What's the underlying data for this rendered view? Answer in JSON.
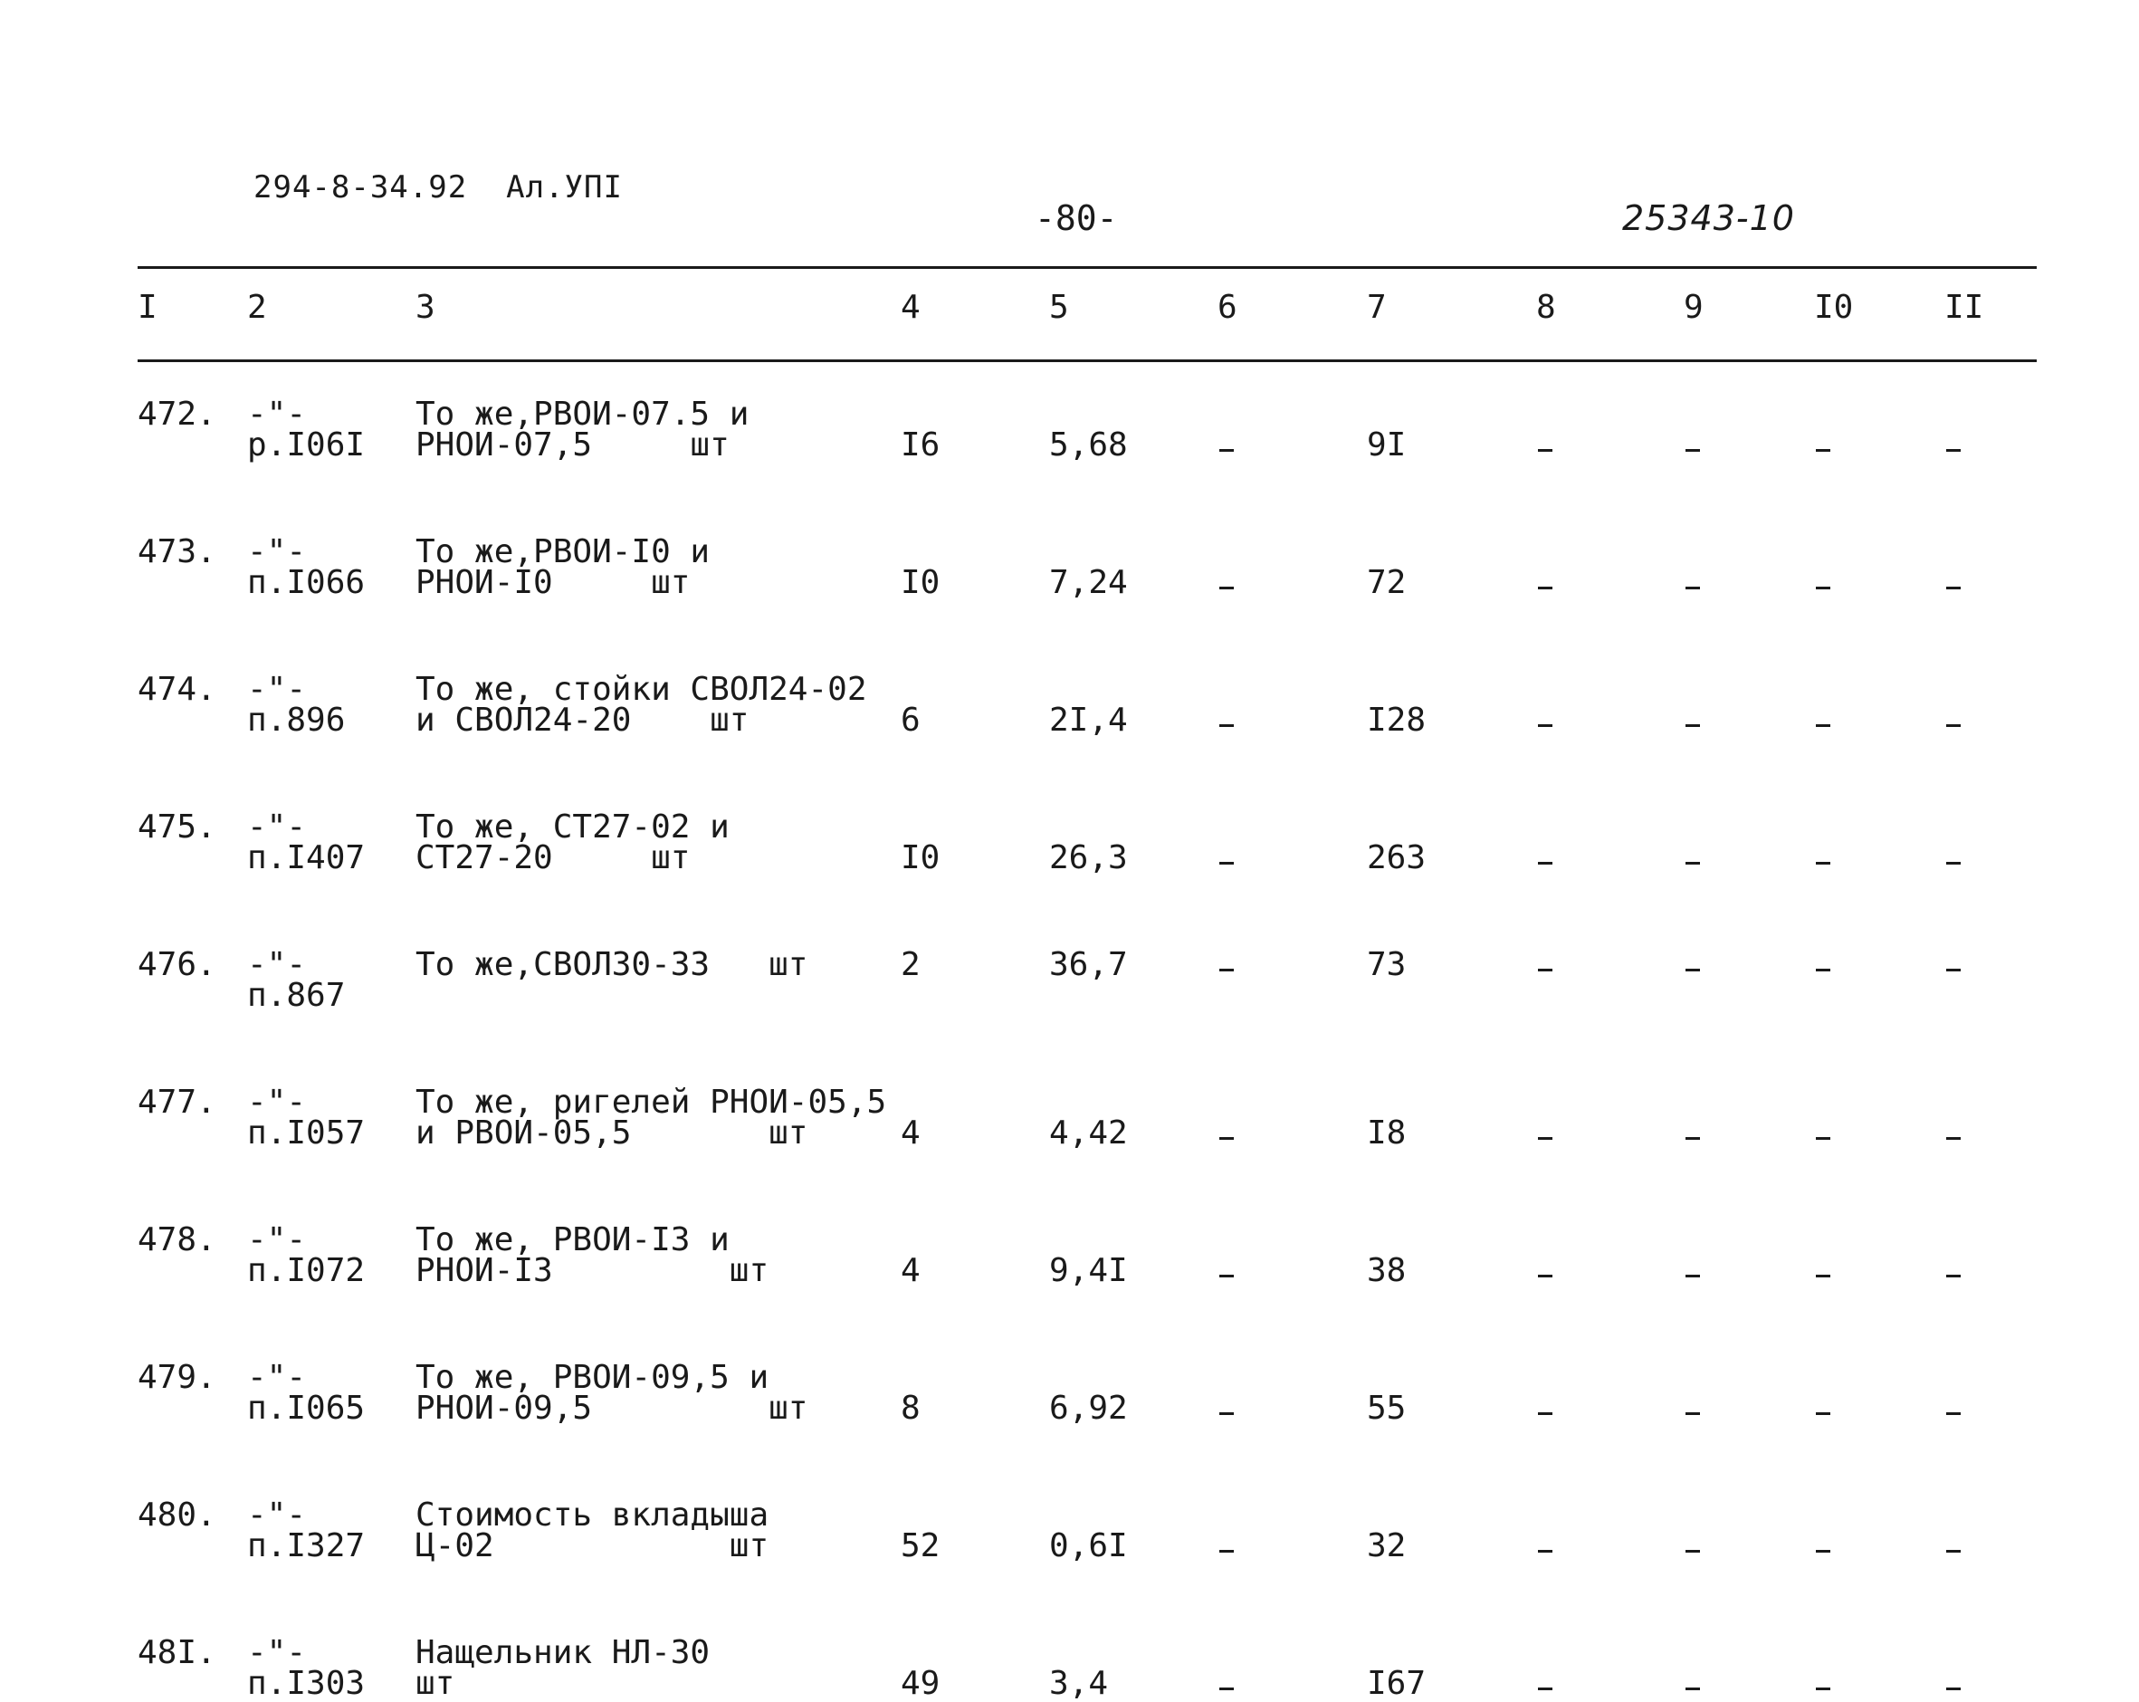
{
  "header": {
    "doc_code": "294-8-34.92  Ал.УПI",
    "page_number": "-80-",
    "inventory_number": "25343-10"
  },
  "columns": [
    "I",
    "2",
    "3",
    "4",
    "5",
    "6",
    "7",
    "8",
    "9",
    "I0",
    "II"
  ],
  "rows": [
    {
      "num": "472.",
      "ref1": "-\"-",
      "ref2": "р.I06I",
      "desc1": "То же,РВОИ-07.5 и",
      "desc2": "РНОИ-07,5     шт",
      "c4": "I6",
      "c5": "5,68",
      "c6": "-",
      "c7": "9I",
      "c8": "-",
      "c9": "-",
      "c10": "-",
      "c11": "-"
    },
    {
      "num": "473.",
      "ref1": "-\"-",
      "ref2": "п.I066",
      "desc1": "То же,РВОИ-I0 и",
      "desc2": "РНОИ-I0     шт",
      "c4": "I0",
      "c5": "7,24",
      "c6": "-",
      "c7": "72",
      "c8": "-",
      "c9": "-",
      "c10": "-",
      "c11": "-"
    },
    {
      "num": "474.",
      "ref1": "-\"-",
      "ref2": "п.896",
      "desc1": "То же, стойки СВОЛ24-02",
      "desc2": "и СВОЛ24-20    шт",
      "c4": "6",
      "c5": "2I,4",
      "c6": "-",
      "c7": "I28",
      "c8": "-",
      "c9": "-",
      "c10": "-",
      "c11": "-"
    },
    {
      "num": "475.",
      "ref1": "-\"-",
      "ref2": "п.I407",
      "desc1": "То же, СТ27-02 и",
      "desc2": "СТ27-20     шт",
      "c4": "I0",
      "c5": "26,3",
      "c6": "-",
      "c7": "263",
      "c8": "-",
      "c9": "-",
      "c10": "-",
      "c11": "-"
    },
    {
      "num": "476.",
      "ref1": "-\"-",
      "ref2": "п.867",
      "desc1": "То же,СВОЛ30-33   шт",
      "desc2": "",
      "c4": "2",
      "c5": "36,7",
      "c6": "-",
      "c7": "73",
      "c8": "-",
      "c9": "-",
      "c10": "-",
      "c11": "-"
    },
    {
      "num": "477.",
      "ref1": "-\"-",
      "ref2": "п.I057",
      "desc1": "То же, ригелей РНОИ-05,5",
      "desc2": "и РВОИ-05,5       шт",
      "c4": "4",
      "c5": "4,42",
      "c6": "-",
      "c7": "I8",
      "c8": "-",
      "c9": "-",
      "c10": "-",
      "c11": "-"
    },
    {
      "num": "478.",
      "ref1": "-\"-",
      "ref2": "п.I072",
      "desc1": "То же, РВОИ-I3 и",
      "desc2": "РНОИ-I3         шт",
      "c4": "4",
      "c5": "9,4I",
      "c6": "-",
      "c7": "38",
      "c8": "-",
      "c9": "-",
      "c10": "-",
      "c11": "-"
    },
    {
      "num": "479.",
      "ref1": "-\"-",
      "ref2": "п.I065",
      "desc1": "То же, РВОИ-09,5 и",
      "desc2": "РНОИ-09,5         шт",
      "c4": "8",
      "c5": "6,92",
      "c6": "-",
      "c7": "55",
      "c8": "-",
      "c9": "-",
      "c10": "-",
      "c11": "-"
    },
    {
      "num": "480.",
      "ref1": "-\"-",
      "ref2": "п.I327",
      "desc1": "Стоимость вкладыша",
      "desc2": "Ц-02            шт",
      "c4": "52",
      "c5": "0,6I",
      "c6": "-",
      "c7": "32",
      "c8": "-",
      "c9": "-",
      "c10": "-",
      "c11": "-"
    },
    {
      "num": "48I.",
      "ref1": "-\"-",
      "ref2": "п.I303",
      "desc1": "Нащельник НЛ-30",
      "desc2": "шт",
      "c4": "49",
      "c5": "3,4",
      "c6": "-",
      "c7": "I67",
      "c8": "-",
      "c9": "-",
      "c10": "-",
      "c11": "-"
    }
  ]
}
